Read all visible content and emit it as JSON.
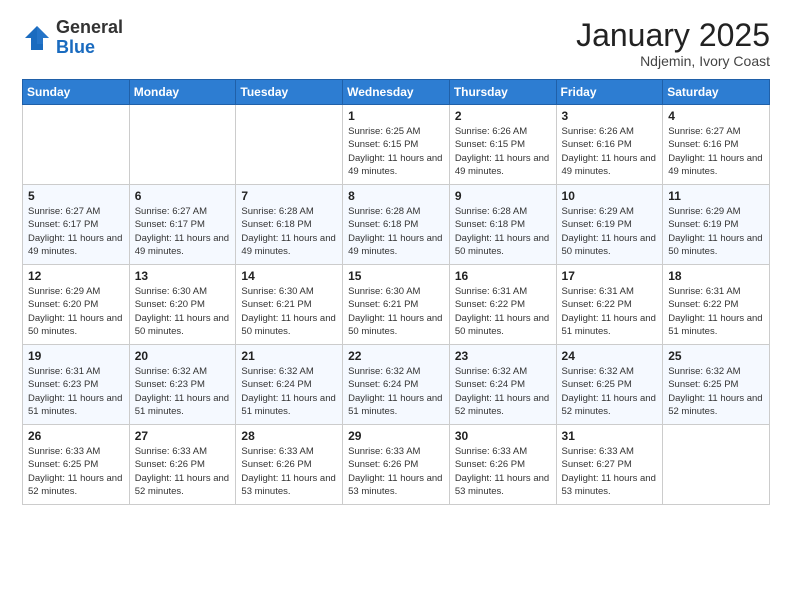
{
  "logo": {
    "general": "General",
    "blue": "Blue"
  },
  "header": {
    "month": "January 2025",
    "location": "Ndjemin, Ivory Coast"
  },
  "days_of_week": [
    "Sunday",
    "Monday",
    "Tuesday",
    "Wednesday",
    "Thursday",
    "Friday",
    "Saturday"
  ],
  "weeks": [
    [
      {
        "day": "",
        "info": ""
      },
      {
        "day": "",
        "info": ""
      },
      {
        "day": "",
        "info": ""
      },
      {
        "day": "1",
        "info": "Sunrise: 6:25 AM\nSunset: 6:15 PM\nDaylight: 11 hours and 49 minutes."
      },
      {
        "day": "2",
        "info": "Sunrise: 6:26 AM\nSunset: 6:15 PM\nDaylight: 11 hours and 49 minutes."
      },
      {
        "day": "3",
        "info": "Sunrise: 6:26 AM\nSunset: 6:16 PM\nDaylight: 11 hours and 49 minutes."
      },
      {
        "day": "4",
        "info": "Sunrise: 6:27 AM\nSunset: 6:16 PM\nDaylight: 11 hours and 49 minutes."
      }
    ],
    [
      {
        "day": "5",
        "info": "Sunrise: 6:27 AM\nSunset: 6:17 PM\nDaylight: 11 hours and 49 minutes."
      },
      {
        "day": "6",
        "info": "Sunrise: 6:27 AM\nSunset: 6:17 PM\nDaylight: 11 hours and 49 minutes."
      },
      {
        "day": "7",
        "info": "Sunrise: 6:28 AM\nSunset: 6:18 PM\nDaylight: 11 hours and 49 minutes."
      },
      {
        "day": "8",
        "info": "Sunrise: 6:28 AM\nSunset: 6:18 PM\nDaylight: 11 hours and 49 minutes."
      },
      {
        "day": "9",
        "info": "Sunrise: 6:28 AM\nSunset: 6:18 PM\nDaylight: 11 hours and 50 minutes."
      },
      {
        "day": "10",
        "info": "Sunrise: 6:29 AM\nSunset: 6:19 PM\nDaylight: 11 hours and 50 minutes."
      },
      {
        "day": "11",
        "info": "Sunrise: 6:29 AM\nSunset: 6:19 PM\nDaylight: 11 hours and 50 minutes."
      }
    ],
    [
      {
        "day": "12",
        "info": "Sunrise: 6:29 AM\nSunset: 6:20 PM\nDaylight: 11 hours and 50 minutes."
      },
      {
        "day": "13",
        "info": "Sunrise: 6:30 AM\nSunset: 6:20 PM\nDaylight: 11 hours and 50 minutes."
      },
      {
        "day": "14",
        "info": "Sunrise: 6:30 AM\nSunset: 6:21 PM\nDaylight: 11 hours and 50 minutes."
      },
      {
        "day": "15",
        "info": "Sunrise: 6:30 AM\nSunset: 6:21 PM\nDaylight: 11 hours and 50 minutes."
      },
      {
        "day": "16",
        "info": "Sunrise: 6:31 AM\nSunset: 6:22 PM\nDaylight: 11 hours and 50 minutes."
      },
      {
        "day": "17",
        "info": "Sunrise: 6:31 AM\nSunset: 6:22 PM\nDaylight: 11 hours and 51 minutes."
      },
      {
        "day": "18",
        "info": "Sunrise: 6:31 AM\nSunset: 6:22 PM\nDaylight: 11 hours and 51 minutes."
      }
    ],
    [
      {
        "day": "19",
        "info": "Sunrise: 6:31 AM\nSunset: 6:23 PM\nDaylight: 11 hours and 51 minutes."
      },
      {
        "day": "20",
        "info": "Sunrise: 6:32 AM\nSunset: 6:23 PM\nDaylight: 11 hours and 51 minutes."
      },
      {
        "day": "21",
        "info": "Sunrise: 6:32 AM\nSunset: 6:24 PM\nDaylight: 11 hours and 51 minutes."
      },
      {
        "day": "22",
        "info": "Sunrise: 6:32 AM\nSunset: 6:24 PM\nDaylight: 11 hours and 51 minutes."
      },
      {
        "day": "23",
        "info": "Sunrise: 6:32 AM\nSunset: 6:24 PM\nDaylight: 11 hours and 52 minutes."
      },
      {
        "day": "24",
        "info": "Sunrise: 6:32 AM\nSunset: 6:25 PM\nDaylight: 11 hours and 52 minutes."
      },
      {
        "day": "25",
        "info": "Sunrise: 6:32 AM\nSunset: 6:25 PM\nDaylight: 11 hours and 52 minutes."
      }
    ],
    [
      {
        "day": "26",
        "info": "Sunrise: 6:33 AM\nSunset: 6:25 PM\nDaylight: 11 hours and 52 minutes."
      },
      {
        "day": "27",
        "info": "Sunrise: 6:33 AM\nSunset: 6:26 PM\nDaylight: 11 hours and 52 minutes."
      },
      {
        "day": "28",
        "info": "Sunrise: 6:33 AM\nSunset: 6:26 PM\nDaylight: 11 hours and 53 minutes."
      },
      {
        "day": "29",
        "info": "Sunrise: 6:33 AM\nSunset: 6:26 PM\nDaylight: 11 hours and 53 minutes."
      },
      {
        "day": "30",
        "info": "Sunrise: 6:33 AM\nSunset: 6:26 PM\nDaylight: 11 hours and 53 minutes."
      },
      {
        "day": "31",
        "info": "Sunrise: 6:33 AM\nSunset: 6:27 PM\nDaylight: 11 hours and 53 minutes."
      },
      {
        "day": "",
        "info": ""
      }
    ]
  ]
}
